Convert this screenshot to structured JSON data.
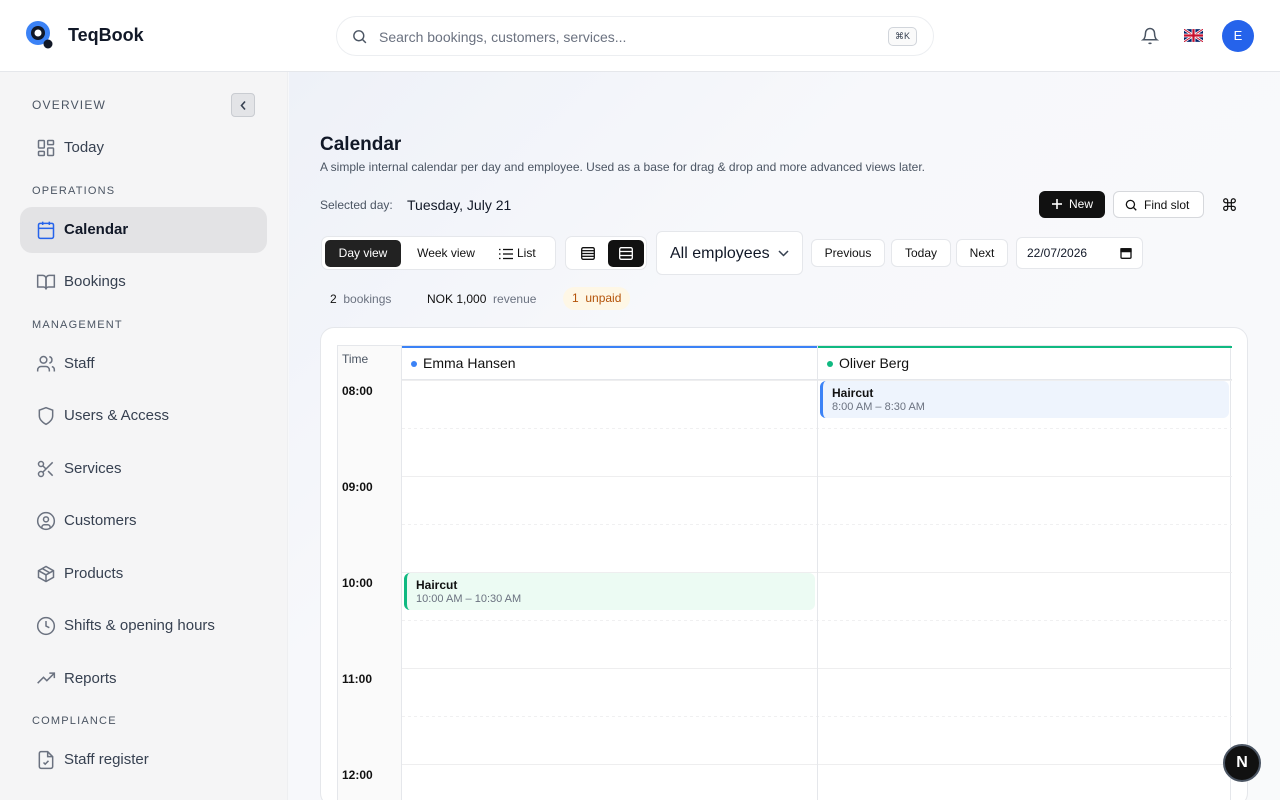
{
  "app": {
    "name": "TeqBook"
  },
  "search": {
    "placeholder": "Search bookings, customers, services...",
    "shortcut": "⌘K"
  },
  "header": {
    "avatar_initial": "E",
    "language_flag": "uk-flag-icon"
  },
  "sidebar": {
    "sections": [
      {
        "label": "OVERVIEW"
      },
      {
        "label": "OPERATIONS"
      },
      {
        "label": "MANAGEMENT"
      },
      {
        "label": "COMPLIANCE"
      }
    ],
    "items": [
      {
        "label": "Today",
        "icon": "grid-icon"
      },
      {
        "label": "Calendar",
        "icon": "calendar-icon",
        "active": true
      },
      {
        "label": "Bookings",
        "icon": "book-icon"
      },
      {
        "label": "Staff",
        "icon": "users-icon"
      },
      {
        "label": "Users & Access",
        "icon": "shield-icon"
      },
      {
        "label": "Services",
        "icon": "scissors-icon"
      },
      {
        "label": "Customers",
        "icon": "user-circle-icon"
      },
      {
        "label": "Products",
        "icon": "package-icon"
      },
      {
        "label": "Shifts & opening hours",
        "icon": "clock-icon"
      },
      {
        "label": "Reports",
        "icon": "trending-up-icon"
      },
      {
        "label": "Staff register",
        "icon": "clipboard-check-icon"
      }
    ]
  },
  "page": {
    "title": "Calendar",
    "subtitle": "A simple internal calendar per day and employee. Used as a base for drag & drop and more advanced views later.",
    "selected_label": "Selected day:",
    "selected_value": "Tuesday, July 21",
    "new_label": "New",
    "find_label": "Find slot",
    "shortcut_symbol": "⌘"
  },
  "toolbar": {
    "views": [
      "Day view",
      "Week view",
      "List"
    ],
    "active_view": "Day view",
    "employee_filter": "All employees",
    "previous": "Previous",
    "today": "Today",
    "next": "Next",
    "date": "22/07/2026"
  },
  "stats": {
    "bookings_count": "2",
    "bookings_label": "bookings",
    "revenue_value": "NOK 1,000",
    "revenue_label": "revenue",
    "unpaid_count": "1",
    "unpaid_label": "unpaid"
  },
  "calendar": {
    "time_header": "Time",
    "hours": [
      "08:00",
      "09:00",
      "10:00",
      "11:00",
      "12:00"
    ],
    "employees": [
      {
        "name": "Emma Hansen",
        "color": "#3b82f6"
      },
      {
        "name": "Oliver Berg",
        "color": "#10b981"
      }
    ],
    "appointments": [
      {
        "employee": "Oliver Berg",
        "title": "Haircut",
        "time": "8:00 AM – 8:30 AM",
        "color": "#3b82f6",
        "bg": "#eef4fd"
      },
      {
        "employee": "Emma Hansen",
        "title": "Haircut",
        "time": "10:00 AM – 10:30 AM",
        "color": "#10b981",
        "bg": "#ecfbf3"
      }
    ]
  },
  "fab": {
    "label": "N"
  }
}
